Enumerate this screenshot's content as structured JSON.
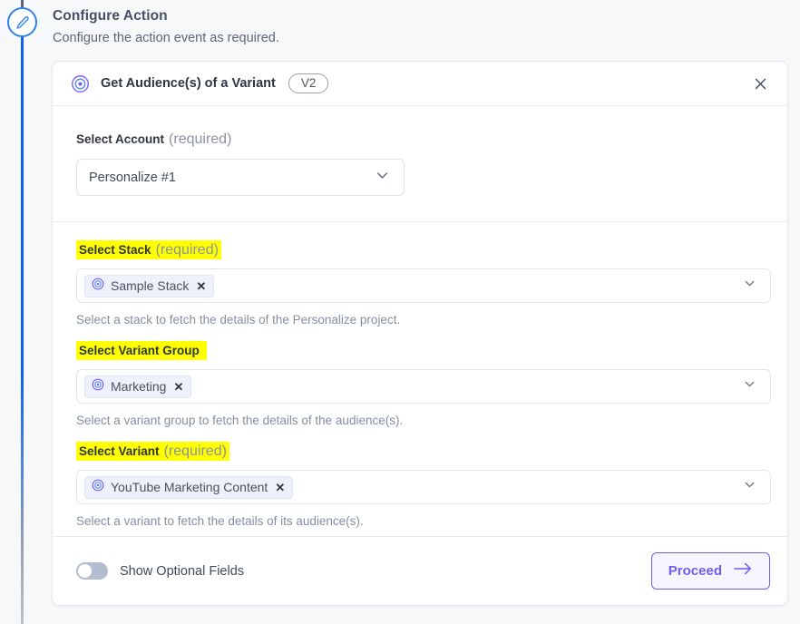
{
  "header": {
    "title": "Configure Action",
    "subtitle": "Configure the action event as required.",
    "rail_icon": "pencil-edit-icon"
  },
  "card": {
    "icon": "target-circles-icon",
    "title": "Get Audience(s) of a Variant",
    "version_badge": "V2",
    "close_icon": "close-icon"
  },
  "account": {
    "label": "Select Account",
    "required_note": "(required)",
    "value": "Personalize #1",
    "chevron_icon": "chevron-down-icon"
  },
  "fields": [
    {
      "label": "Select Stack",
      "required_note": "(required)",
      "highlighted": true,
      "chip": "Sample Stack",
      "chip_icon": "target-circles-icon",
      "chip_remove_icon": "remove-x-icon",
      "helper": "Select a stack to fetch the details of the Personalize project.",
      "chevron_icon": "chevron-down-icon"
    },
    {
      "label": "Select Variant Group",
      "required_note": "",
      "highlighted": true,
      "chip": "Marketing",
      "chip_icon": "target-circles-icon",
      "chip_remove_icon": "remove-x-icon",
      "helper": "Select a variant group to fetch the details of the audience(s).",
      "chevron_icon": "chevron-down-icon"
    },
    {
      "label": "Select Variant",
      "required_note": "(required)",
      "highlighted": true,
      "chip": "YouTube Marketing Content",
      "chip_icon": "target-circles-icon",
      "chip_remove_icon": "remove-x-icon",
      "helper": "Select a variant to fetch the details of its audience(s).",
      "chevron_icon": "chevron-down-icon"
    }
  ],
  "footer": {
    "toggle_label": "Show Optional Fields",
    "toggle_state": "off",
    "proceed_label": "Proceed",
    "proceed_icon": "arrow-right-icon"
  },
  "colors": {
    "highlight": "#ffff00",
    "accent_purple": "#6f5cf0",
    "rail_blue": "#0b63f6"
  }
}
